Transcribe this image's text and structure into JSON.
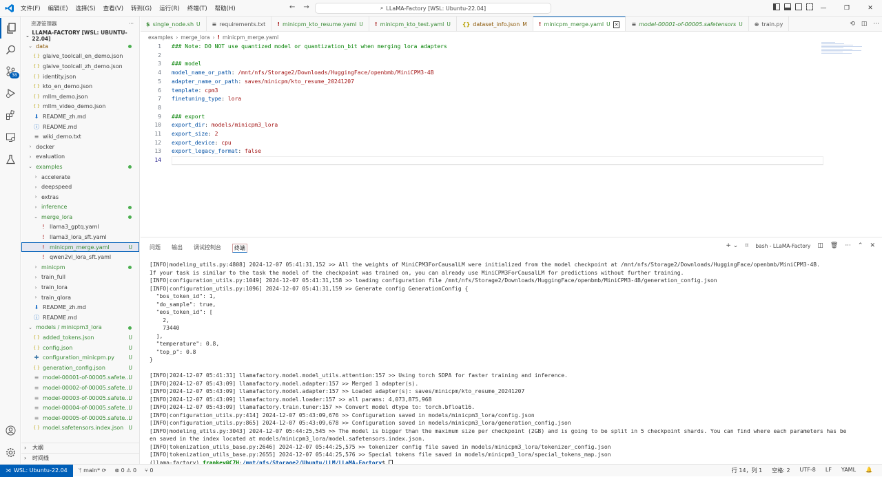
{
  "titlebar": {
    "menu": [
      "文件(F)",
      "编辑(E)",
      "选择(S)",
      "查看(V)",
      "转到(G)",
      "运行(R)",
      "终端(T)",
      "帮助(H)"
    ],
    "command_center": "LLaMA-Factory [WSL: Ubuntu-22.04]"
  },
  "activity": {
    "scm_badge": "38"
  },
  "sidebar": {
    "header": "资源管理器",
    "root": "LLAMA-FACTORY [WSL: UBUNTU-22.04]",
    "items": [
      {
        "label": "data",
        "depth": 1,
        "kind": "folder-open",
        "color": "brown",
        "dot": true
      },
      {
        "label": "glaive_toolcall_en_demo.json",
        "depth": 2,
        "kind": "json"
      },
      {
        "label": "glaive_toolcall_zh_demo.json",
        "depth": 2,
        "kind": "json"
      },
      {
        "label": "identity.json",
        "depth": 2,
        "kind": "json"
      },
      {
        "label": "kto_en_demo.json",
        "depth": 2,
        "kind": "json"
      },
      {
        "label": "mllm_demo.json",
        "depth": 2,
        "kind": "json"
      },
      {
        "label": "mllm_video_demo.json",
        "depth": 2,
        "kind": "json"
      },
      {
        "label": "README_zh.md",
        "depth": 2,
        "kind": "md-down"
      },
      {
        "label": "README.md",
        "depth": 2,
        "kind": "info"
      },
      {
        "label": "wiki_demo.txt",
        "depth": 2,
        "kind": "txt"
      },
      {
        "label": "docker",
        "depth": 1,
        "kind": "folder"
      },
      {
        "label": "evaluation",
        "depth": 1,
        "kind": "folder"
      },
      {
        "label": "examples",
        "depth": 1,
        "kind": "folder-open",
        "color": "green",
        "dot": true
      },
      {
        "label": "accelerate",
        "depth": 2,
        "kind": "folder"
      },
      {
        "label": "deepspeed",
        "depth": 2,
        "kind": "folder"
      },
      {
        "label": "extras",
        "depth": 2,
        "kind": "folder"
      },
      {
        "label": "inference",
        "depth": 2,
        "kind": "folder",
        "color": "green",
        "dot": true
      },
      {
        "label": "merge_lora",
        "depth": 2,
        "kind": "folder-open",
        "color": "green",
        "dot": true
      },
      {
        "label": "llama3_gptq.yaml",
        "depth": 3,
        "kind": "yaml"
      },
      {
        "label": "llama3_lora_sft.yaml",
        "depth": 3,
        "kind": "yaml"
      },
      {
        "label": "minicpm_merge.yaml",
        "depth": 3,
        "kind": "yaml",
        "color": "green",
        "status": "U",
        "selected": true
      },
      {
        "label": "qwen2vl_lora_sft.yaml",
        "depth": 3,
        "kind": "yaml"
      },
      {
        "label": "minicpm",
        "depth": 2,
        "kind": "folder",
        "color": "green",
        "dot": true
      },
      {
        "label": "train_full",
        "depth": 2,
        "kind": "folder"
      },
      {
        "label": "train_lora",
        "depth": 2,
        "kind": "folder"
      },
      {
        "label": "train_qlora",
        "depth": 2,
        "kind": "folder"
      },
      {
        "label": "README_zh.md",
        "depth": 2,
        "kind": "md-down"
      },
      {
        "label": "README.md",
        "depth": 2,
        "kind": "info"
      },
      {
        "label": "models / minicpm3_lora",
        "depth": 1,
        "kind": "folder-open",
        "color": "green",
        "dot": true
      },
      {
        "label": "added_tokens.json",
        "depth": 2,
        "kind": "json",
        "color": "green",
        "status": "U"
      },
      {
        "label": "config.json",
        "depth": 2,
        "kind": "json",
        "color": "green",
        "status": "U"
      },
      {
        "label": "configuration_minicpm.py",
        "depth": 2,
        "kind": "py",
        "color": "green",
        "status": "U"
      },
      {
        "label": "generation_config.json",
        "depth": 2,
        "kind": "json",
        "color": "green",
        "status": "U"
      },
      {
        "label": "model-00001-of-00005.safete...",
        "depth": 2,
        "kind": "file",
        "color": "green",
        "status": "U"
      },
      {
        "label": "model-00002-of-00005.safete...",
        "depth": 2,
        "kind": "file",
        "color": "green",
        "status": "U"
      },
      {
        "label": "model-00003-of-00005.safete...",
        "depth": 2,
        "kind": "file",
        "color": "green",
        "status": "U"
      },
      {
        "label": "model-00004-of-00005.safete...",
        "depth": 2,
        "kind": "file",
        "color": "green",
        "status": "U"
      },
      {
        "label": "model-00005-of-00005.safete...",
        "depth": 2,
        "kind": "file",
        "color": "green",
        "status": "U"
      },
      {
        "label": "model.safetensors.index.json",
        "depth": 2,
        "kind": "json",
        "color": "green",
        "status": "U"
      }
    ],
    "outline": "大纲",
    "timeline": "时间线"
  },
  "tabs": [
    {
      "icon": "$",
      "label": "single_node.sh",
      "status": "U",
      "color": "green"
    },
    {
      "icon": "≡",
      "label": "requirements.txt",
      "status": "",
      "color": ""
    },
    {
      "icon": "!",
      "label": "minicpm_kto_resume.yaml",
      "status": "U",
      "color": "green"
    },
    {
      "icon": "!",
      "label": "minicpm_kto_test.yaml",
      "status": "U",
      "color": "green"
    },
    {
      "icon": "{}",
      "label": "dataset_info.json",
      "status": "M",
      "color": "brown"
    },
    {
      "icon": "!",
      "label": "minicpm_merge.yaml",
      "status": "U",
      "color": "green",
      "active": true
    },
    {
      "icon": "≡",
      "label": "model-00001-of-00005.safetensors",
      "status": "U",
      "color": "green"
    },
    {
      "icon": "⊕",
      "label": "train.py",
      "status": "",
      "color": ""
    }
  ],
  "breadcrumb": [
    "examples",
    "merge_lora",
    "minicpm_merge.yaml"
  ],
  "editor": {
    "lines": [
      [
        {
          "t": "### Note: DO NOT use quantized model or quantization_bit when merging lora adapters",
          "c": "com"
        }
      ],
      [],
      [
        {
          "t": "### model",
          "c": "com"
        }
      ],
      [
        {
          "t": "model_name_or_path",
          "c": "key"
        },
        {
          "t": ": ",
          "c": ""
        },
        {
          "t": "/mnt/nfs/Storage2/Downloads/HuggingFace/openbmb/MiniCPM3-4B",
          "c": "str"
        }
      ],
      [
        {
          "t": "adapter_name_or_path",
          "c": "key"
        },
        {
          "t": ": ",
          "c": ""
        },
        {
          "t": "saves/minicpm/kto_resume_20241207",
          "c": "str"
        }
      ],
      [
        {
          "t": "template",
          "c": "key"
        },
        {
          "t": ": ",
          "c": ""
        },
        {
          "t": "cpm3",
          "c": "str"
        }
      ],
      [
        {
          "t": "finetuning_type",
          "c": "key"
        },
        {
          "t": ": ",
          "c": ""
        },
        {
          "t": "lora",
          "c": "str"
        }
      ],
      [],
      [
        {
          "t": "### export",
          "c": "com"
        }
      ],
      [
        {
          "t": "export_dir",
          "c": "key"
        },
        {
          "t": ": ",
          "c": ""
        },
        {
          "t": "models/minicpm3_lora",
          "c": "str"
        }
      ],
      [
        {
          "t": "export_size",
          "c": "key"
        },
        {
          "t": ": ",
          "c": ""
        },
        {
          "t": "2",
          "c": "str"
        }
      ],
      [
        {
          "t": "export_device",
          "c": "key"
        },
        {
          "t": ": ",
          "c": ""
        },
        {
          "t": "cpu",
          "c": "str"
        }
      ],
      [
        {
          "t": "export_legacy_format",
          "c": "key"
        },
        {
          "t": ": ",
          "c": ""
        },
        {
          "t": "false",
          "c": "str"
        }
      ],
      []
    ]
  },
  "panel": {
    "tabs": [
      "问题",
      "输出",
      "调试控制台",
      "终端"
    ],
    "active_tab": "终端",
    "shell_label": "bash - LLaMA-Factory",
    "terminal_lines": [
      "[INFO|modeling_utils.py:4808] 2024-12-07 05:41:31,152 >> All the weights of MiniCPM3ForCausalLM were initialized from the model checkpoint at /mnt/nfs/Storage2/Downloads/HuggingFace/openbmb/MiniCPM3-4B.",
      "If your task is similar to the task the model of the checkpoint was trained on, you can already use MiniCPM3ForCausalLM for predictions without further training.",
      "[INFO|configuration_utils.py:1049] 2024-12-07 05:41:31,158 >> loading configuration file /mnt/nfs/Storage2/Downloads/HuggingFace/openbmb/MiniCPM3-4B/generation_config.json",
      "[INFO|configuration_utils.py:1096] 2024-12-07 05:41:31,159 >> Generate config GenerationConfig {",
      "  \"bos_token_id\": 1,",
      "  \"do_sample\": true,",
      "  \"eos_token_id\": [",
      "    2,",
      "    73440",
      "  ],",
      "  \"temperature\": 0.8,",
      "  \"top_p\": 0.8",
      "}",
      "",
      "[INFO|2024-12-07 05:41:31] llamafactory.model.model_utils.attention:157 >> Using torch SDPA for faster training and inference.",
      "[INFO|2024-12-07 05:43:09] llamafactory.model.adapter:157 >> Merged 1 adapter(s).",
      "[INFO|2024-12-07 05:43:09] llamafactory.model.adapter:157 >> Loaded adapter(s): saves/minicpm/kto_resume_20241207",
      "[INFO|2024-12-07 05:43:09] llamafactory.model.loader:157 >> all params: 4,073,875,968",
      "[INFO|2024-12-07 05:43:09] llamafactory.train.tuner:157 >> Convert model dtype to: torch.bfloat16.",
      "[INFO|configuration_utils.py:414] 2024-12-07 05:43:09,676 >> Configuration saved in models/minicpm3_lora/config.json",
      "[INFO|configuration_utils.py:865] 2024-12-07 05:43:09,678 >> Configuration saved in models/minicpm3_lora/generation_config.json",
      "[INFO|modeling_utils.py:3043] 2024-12-07 05:44:25,545 >> The model is bigger than the maximum size per checkpoint (2GB) and is going to be split in 5 checkpoint shards. You can find where each parameters has be",
      "en saved in the index located at models/minicpm3_lora/model.safetensors.index.json.",
      "[INFO|tokenization_utils_base.py:2646] 2024-12-07 05:44:25,575 >> tokenizer config file saved in models/minicpm3_lora/tokenizer_config.json",
      "[INFO|tokenization_utils_base.py:2655] 2024-12-07 05:44:25,576 >> Special tokens file saved in models/minicpm3_lora/special_tokens_map.json"
    ],
    "prompt_env": "(llama-factory) ",
    "prompt_user": "frankey@C7H",
    "prompt_sep": ":",
    "prompt_path": "/mnt/nfs/Storage2/Ubuntu/LLM/LLaMA-Factory",
    "prompt_end": "$ "
  },
  "status": {
    "remote": "WSL: Ubuntu-22.04",
    "branch": "main*",
    "problems": "⊗ 0 ⚠ 0",
    "ports": "0",
    "position": "行 14，列 1",
    "spaces": "空格: 2",
    "encoding": "UTF-8",
    "eol": "LF",
    "language": "YAML"
  },
  "colors": {
    "accent": "#005fb8",
    "git_untracked": "#388a34",
    "git_modified": "#895503"
  }
}
